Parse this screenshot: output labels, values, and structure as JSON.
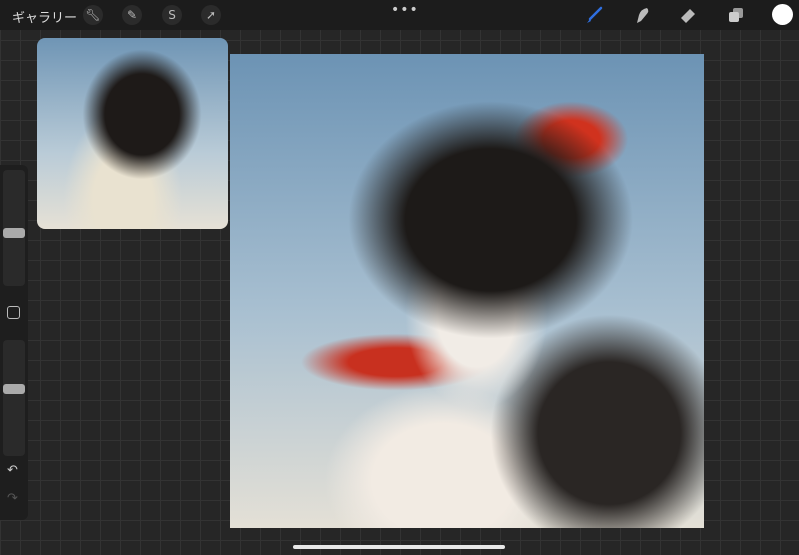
{
  "topbar": {
    "gallery_label": "ギャラリー",
    "more": "•••",
    "left_icons": [
      "wrench-icon",
      "magic-wand-icon",
      "selection-icon",
      "transform-arrow-icon"
    ],
    "right_icons": [
      "brush-icon",
      "smudge-icon",
      "eraser-icon",
      "layers-icon"
    ],
    "active_tool": "brush",
    "brush_color": "#2f6fe0",
    "current_color": "#ffffff"
  },
  "sidebar": {
    "brush_size": 0.45,
    "opacity": 0.6
  }
}
